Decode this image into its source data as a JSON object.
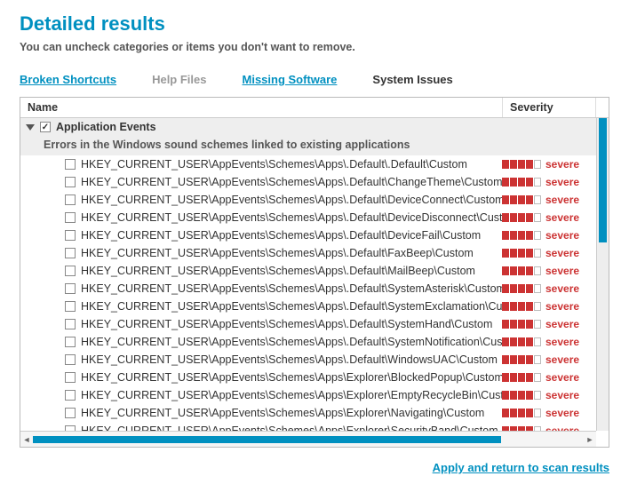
{
  "header": {
    "title": "Detailed results",
    "subtitle": "You can uncheck categories or items you don't want to remove."
  },
  "tabs": {
    "broken_shortcuts": "Broken Shortcuts",
    "help_files": "Help Files",
    "missing_software": "Missing Software",
    "system_issues": "System Issues"
  },
  "columns": {
    "name": "Name",
    "severity": "Severity"
  },
  "group": {
    "title": "Application Events",
    "desc": "Errors in the Windows sound schemes linked to existing applications",
    "checked": true
  },
  "severity_label": "severe",
  "rows": [
    "HKEY_CURRENT_USER\\AppEvents\\Schemes\\Apps\\.Default\\.Default\\Custom",
    "HKEY_CURRENT_USER\\AppEvents\\Schemes\\Apps\\.Default\\ChangeTheme\\Custom",
    "HKEY_CURRENT_USER\\AppEvents\\Schemes\\Apps\\.Default\\DeviceConnect\\Custom",
    "HKEY_CURRENT_USER\\AppEvents\\Schemes\\Apps\\.Default\\DeviceDisconnect\\Custom",
    "HKEY_CURRENT_USER\\AppEvents\\Schemes\\Apps\\.Default\\DeviceFail\\Custom",
    "HKEY_CURRENT_USER\\AppEvents\\Schemes\\Apps\\.Default\\FaxBeep\\Custom",
    "HKEY_CURRENT_USER\\AppEvents\\Schemes\\Apps\\.Default\\MailBeep\\Custom",
    "HKEY_CURRENT_USER\\AppEvents\\Schemes\\Apps\\.Default\\SystemAsterisk\\Custom",
    "HKEY_CURRENT_USER\\AppEvents\\Schemes\\Apps\\.Default\\SystemExclamation\\Custom",
    "HKEY_CURRENT_USER\\AppEvents\\Schemes\\Apps\\.Default\\SystemHand\\Custom",
    "HKEY_CURRENT_USER\\AppEvents\\Schemes\\Apps\\.Default\\SystemNotification\\Custom",
    "HKEY_CURRENT_USER\\AppEvents\\Schemes\\Apps\\.Default\\WindowsUAC\\Custom",
    "HKEY_CURRENT_USER\\AppEvents\\Schemes\\Apps\\Explorer\\BlockedPopup\\Custom",
    "HKEY_CURRENT_USER\\AppEvents\\Schemes\\Apps\\Explorer\\EmptyRecycleBin\\Custom",
    "HKEY_CURRENT_USER\\AppEvents\\Schemes\\Apps\\Explorer\\Navigating\\Custom",
    "HKEY_CURRENT_USER\\AppEvents\\Schemes\\Apps\\Explorer\\SecurityBand\\Custom"
  ],
  "footer": {
    "apply": "Apply and return to scan results"
  }
}
